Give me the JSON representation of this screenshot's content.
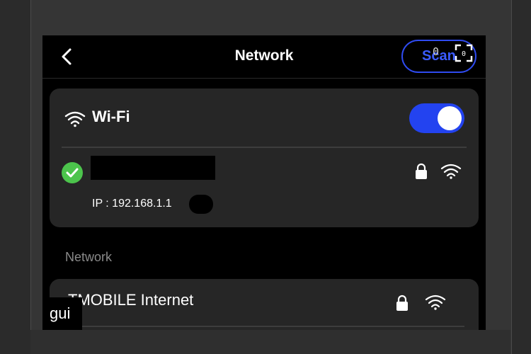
{
  "header": {
    "title": "Network",
    "scan_label": "Scan",
    "overlay_counter": "0"
  },
  "wifi": {
    "title": "Wi-Fi",
    "enabled": true,
    "connected": {
      "ip_label": "IP : 192.168.1.1"
    }
  },
  "networks_section": {
    "label": "Network",
    "items": [
      {
        "name": "TMOBILE Internet",
        "secured": true
      }
    ]
  },
  "overlay": {
    "gui_label": "gui"
  },
  "colors": {
    "accent": "#2343f0",
    "connected_green": "#4cc44c",
    "card_bg": "#262626",
    "screen_bg": "#000000"
  },
  "icons": [
    "back-chevron-icon",
    "fullscreen-icon",
    "wifi-icon",
    "check-circle-icon",
    "lock-icon",
    "wifi-signal-icon"
  ]
}
